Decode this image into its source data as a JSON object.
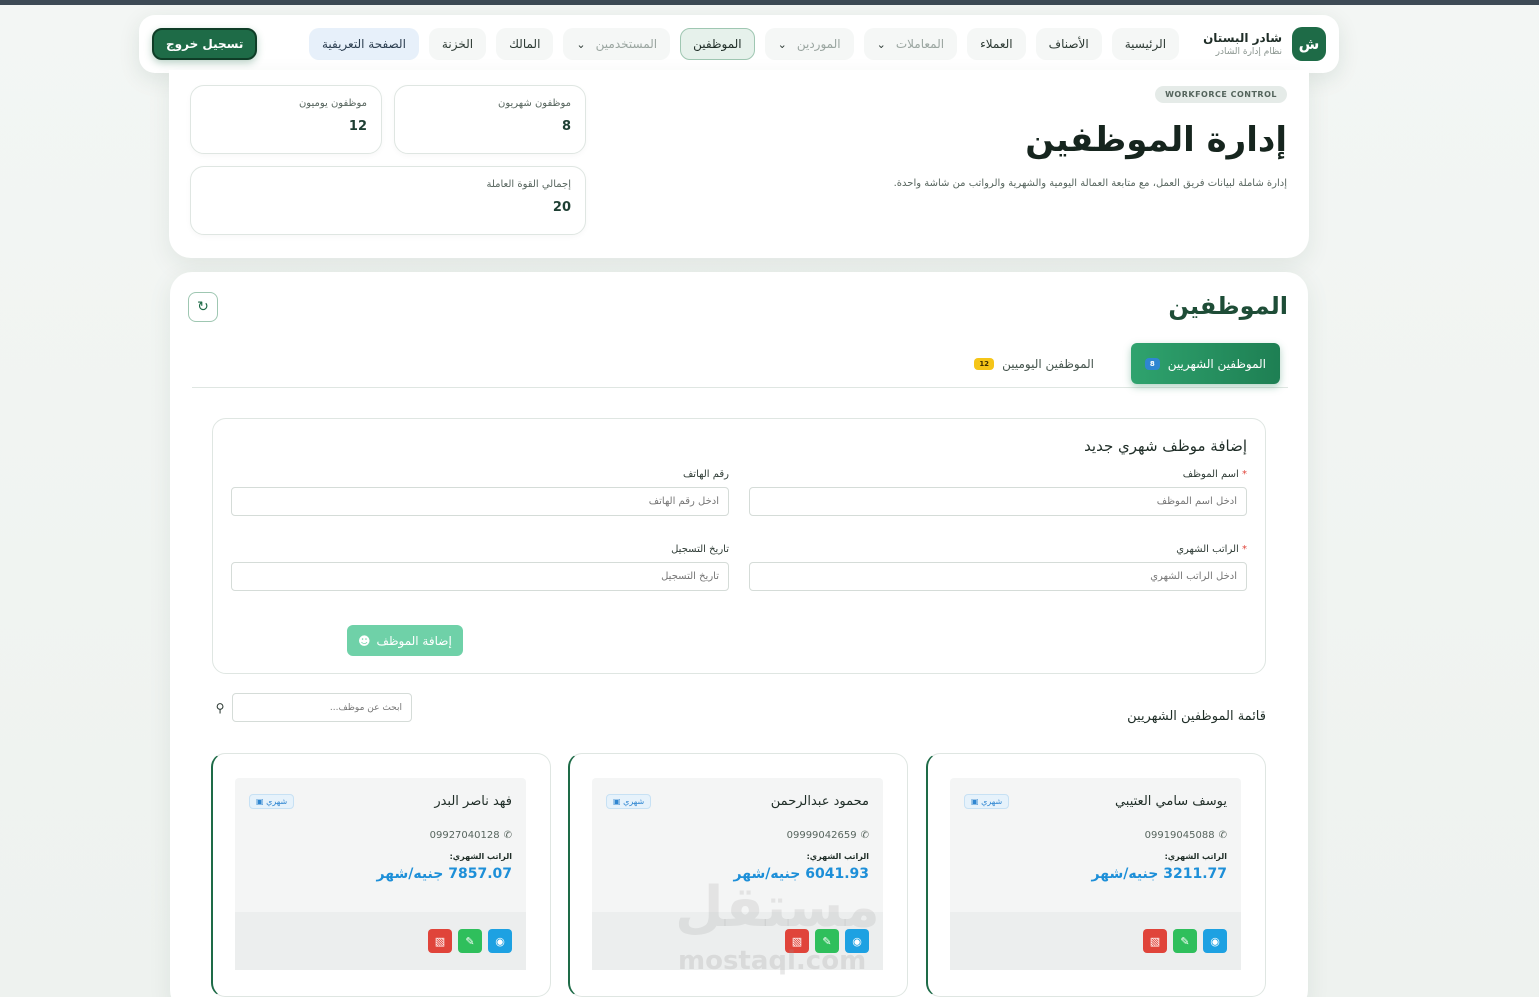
{
  "brand": {
    "logo_letter": "ش",
    "title": "شادر البستان",
    "subtitle": "نظام إدارة الشادر"
  },
  "nav": {
    "home": "الرئيسية",
    "items_cat": "الأصناف",
    "clients": "العملاء",
    "transactions": "المعاملات",
    "suppliers": "الموردين",
    "employees": "الموظفين",
    "users": "المستخدمين",
    "owner": "المالك",
    "treasury": "الخزنة",
    "about": "الصفحة التعريفية",
    "logout": "تسجيل خروج"
  },
  "hero": {
    "badge": "WORKFORCE CONTROL",
    "title": "إدارة الموظفين",
    "description": "إدارة شاملة لبيانات فريق العمل، مع متابعة العمالة اليومية والشهرية والرواتب من شاشة واحدة."
  },
  "stats": {
    "monthly": {
      "label": "موظفون شهريون",
      "value": "8"
    },
    "daily": {
      "label": "موظفون يوميون",
      "value": "12"
    },
    "total": {
      "label": "إجمالي القوة العاملة",
      "value": "20"
    }
  },
  "main": {
    "title": "الموظفين",
    "tabs": {
      "monthly": {
        "label": "الموظفين الشهريين",
        "count": "8"
      },
      "daily": {
        "label": "الموظفين اليوميين",
        "count": "12"
      }
    }
  },
  "form": {
    "title": "إضافة موظف شهري جديد",
    "name_label": "اسم الموظف",
    "name_placeholder": "أدخل اسم الموظف",
    "phone_label": "رقم الهاتف",
    "phone_placeholder": "أدخل رقم الهاتف",
    "salary_label": "الراتب الشهري",
    "salary_placeholder": "أدخل الراتب الشهري",
    "date_label": "تاريخ التسجيل",
    "date_placeholder": "تاريخ التسجيل",
    "required_mark": "*",
    "submit": "إضافة الموظف"
  },
  "list": {
    "title": "قائمة الموظفين الشهريين",
    "search_placeholder": "ابحث عن موظف...",
    "salary_label": "الراتب الشهري:",
    "type_tag": "شهري",
    "employees": [
      {
        "name": "يوسف سامي العتيبي",
        "phone": "09919045088",
        "salary": "3211.77 جنيه/شهر"
      },
      {
        "name": "محمود عبدالرحمن",
        "phone": "09999042659",
        "salary": "6041.93 جنيه/شهر"
      },
      {
        "name": "فهد ناصر البدر",
        "phone": "09927040128",
        "salary": "7857.07 جنيه/شهر"
      }
    ]
  },
  "watermark": {
    "text": "مستقل",
    "sub": "mostaql.com"
  },
  "colors": {
    "brand": "#1e6b47",
    "accent_blue": "#1d8fd8",
    "danger": "#e0443a",
    "success": "#2fbf5c"
  },
  "icons": [
    "refresh-icon",
    "chevron-down-icon",
    "phone-icon",
    "lock-icon",
    "eye-icon",
    "pencil-icon",
    "trash-icon",
    "search-icon",
    "user-plus-icon"
  ]
}
